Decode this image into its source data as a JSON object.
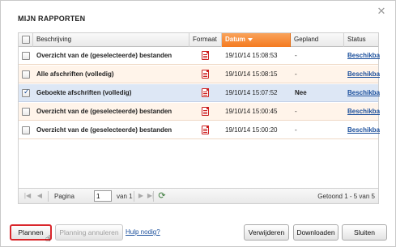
{
  "dialog": {
    "title": "MIJN RAPPORTEN",
    "close_icon": "close-icon"
  },
  "table": {
    "headers": {
      "beschrijving": "Beschrijving",
      "formaat": "Formaat",
      "datum": "Datum",
      "gepland": "Gepland",
      "status": "Status"
    },
    "sorted_column": "Datum",
    "sort_direction": "descending",
    "rows": [
      {
        "checked": false,
        "beschrijving": "Overzicht van de (geselecteerde) bestanden",
        "formaat_icon": "pdf-icon",
        "datum": "19/10/14 15:08:53",
        "gepland": "-",
        "status": "Beschikbaar"
      },
      {
        "checked": false,
        "beschrijving": "Alle afschriften (volledig)",
        "formaat_icon": "pdf-icon",
        "datum": "19/10/14 15:08:15",
        "gepland": "-",
        "status": "Beschikbaar"
      },
      {
        "checked": true,
        "beschrijving": "Geboekte afschriften (volledig)",
        "formaat_icon": "pdf-icon",
        "datum": "19/10/14 15:07:52",
        "gepland": "Nee",
        "status": "Beschikbaar"
      },
      {
        "checked": false,
        "beschrijving": "Overzicht van de (geselecteerde) bestanden",
        "formaat_icon": "pdf-icon",
        "datum": "19/10/14 15:00:45",
        "gepland": "-",
        "status": "Beschikbaar"
      },
      {
        "checked": false,
        "beschrijving": "Overzicht van de (geselecteerde) bestanden",
        "formaat_icon": "pdf-icon",
        "datum": "19/10/14 15:00:20",
        "gepland": "-",
        "status": "Beschikbaar"
      }
    ]
  },
  "pager": {
    "pagina_label": "Pagina",
    "page_value": "1",
    "van_label": "van 1",
    "summary": "Getoond 1 - 5 van 5"
  },
  "buttons": {
    "plannen": "Plannen",
    "planning_annuleren": "Planning annuleren",
    "hulp": "Hulp nodig?",
    "verwijderen": "Verwijderen",
    "downloaden": "Downloaden",
    "sluiten": "Sluiten"
  },
  "colors": {
    "accent": "#f47a20",
    "primary_outline": "#d9262b",
    "link": "#1b4f9c"
  }
}
